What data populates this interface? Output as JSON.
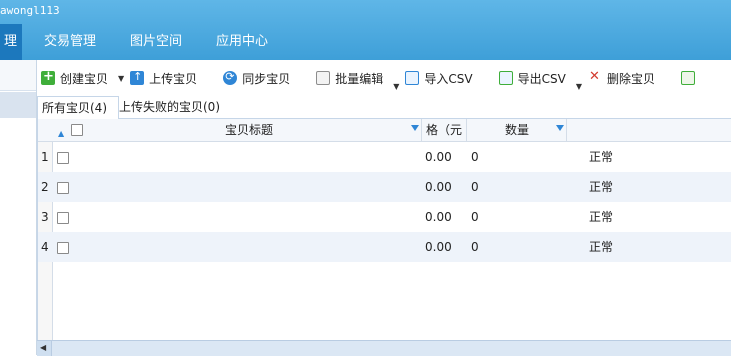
{
  "app": {
    "title": "awongl113"
  },
  "nav": {
    "items": [
      {
        "label": "理"
      },
      {
        "label": "交易管理"
      },
      {
        "label": "图片空间"
      },
      {
        "label": "应用中心"
      }
    ]
  },
  "toolbar": {
    "create": "创建宝贝",
    "upload": "上传宝贝",
    "sync": "同步宝贝",
    "bulk_edit": "批量编辑",
    "import_csv": "导入CSV",
    "export_csv": "导出CSV",
    "delete": "删除宝贝"
  },
  "tabs": [
    {
      "label": "所有宝贝(4)"
    },
    {
      "label": "上传失败的宝贝(0)"
    }
  ],
  "grid": {
    "headers": {
      "title": "宝贝标题",
      "price": "格（元",
      "quantity": "数量"
    },
    "rows": [
      {
        "num": "1",
        "price": "0.00",
        "quantity": "0",
        "status": "正常"
      },
      {
        "num": "2",
        "price": "0.00",
        "quantity": "0",
        "status": "正常"
      },
      {
        "num": "3",
        "price": "0.00",
        "quantity": "0",
        "status": "正常"
      },
      {
        "num": "4",
        "price": "0.00",
        "quantity": "0",
        "status": "正常"
      }
    ]
  }
}
